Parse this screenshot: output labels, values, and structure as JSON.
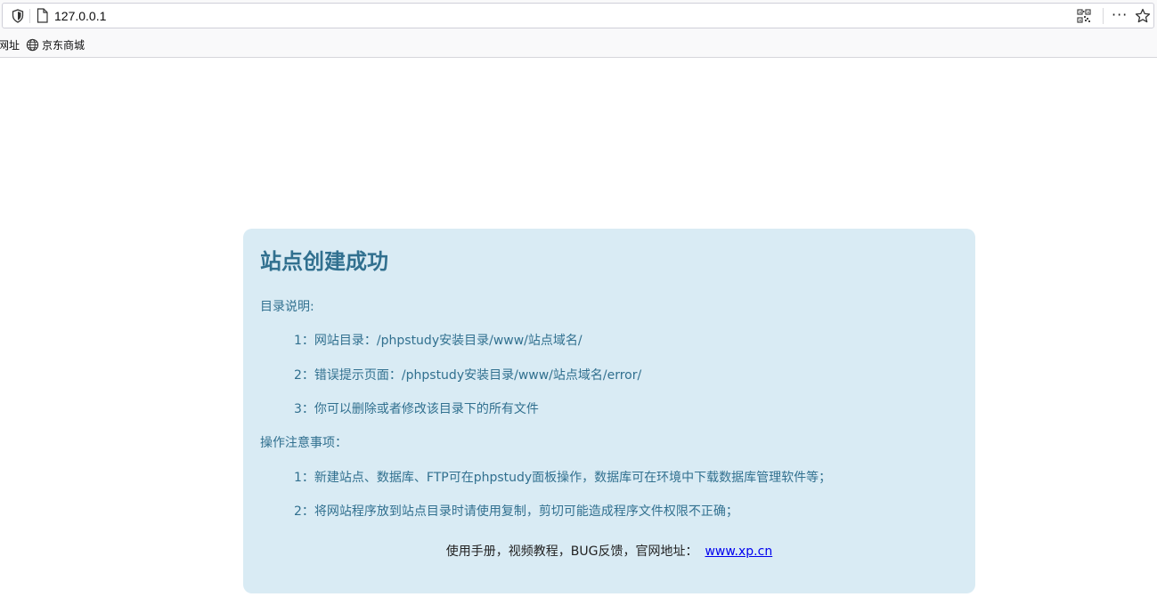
{
  "browser": {
    "url": "127.0.0.1",
    "more_glyph": "···",
    "bookmarks": [
      {
        "label": "网址"
      },
      {
        "label": "京东商城",
        "icon": "globe-icon"
      }
    ],
    "icons": [
      "shield-icon",
      "page-icon",
      "qr-code-icon",
      "more-icon",
      "star-icon"
    ]
  },
  "panel": {
    "title": "站点创建成功",
    "dir_heading": "目录说明:",
    "dir_items": [
      "1：网站目录：/phpstudy安装目录/www/站点域名/",
      "2：错误提示页面：/phpstudy安装目录/www/站点域名/error/",
      "3：你可以删除或者修改该目录下的所有文件"
    ],
    "notes_heading": "操作注意事项：",
    "notes_items": [
      "1：新建站点、数据库、FTP可在phpstudy面板操作，数据库可在环境中下载数据库管理软件等；",
      "2：将网站程序放到站点目录时请使用复制，剪切可能造成程序文件权限不正确；"
    ],
    "footer_text": "使用手册，视频教程，BUG反馈，官网地址：",
    "footer_link": "www.xp.cn"
  },
  "colors": {
    "panel_bg": "#d9ebf4",
    "panel_text": "#31708f",
    "link": "#0000ee"
  }
}
